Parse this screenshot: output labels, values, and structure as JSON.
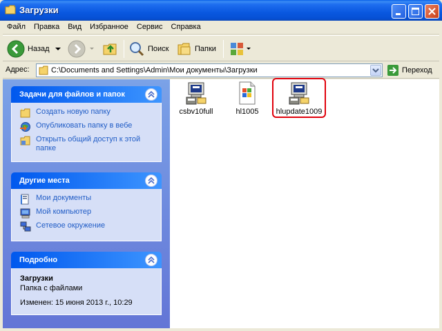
{
  "window": {
    "title": "Загрузки"
  },
  "menu": [
    "Файл",
    "Правка",
    "Вид",
    "Избранное",
    "Сервис",
    "Справка"
  ],
  "toolbar": {
    "back_label": "Назад",
    "search_label": "Поиск",
    "folders_label": "Папки"
  },
  "address": {
    "label": "Адрес:",
    "path": "C:\\Documents and Settings\\Admin\\Мои документы\\Загрузки",
    "go_label": "Переход"
  },
  "tasks_panel": {
    "title": "Задачи для файлов и папок",
    "items": [
      {
        "label": "Создать новую папку",
        "icon": "new-folder-icon"
      },
      {
        "label": "Опубликовать папку в вебе",
        "icon": "publish-web-icon"
      },
      {
        "label": "Открыть общий доступ к этой папке",
        "icon": "share-folder-icon"
      }
    ]
  },
  "places_panel": {
    "title": "Другие места",
    "items": [
      {
        "label": "Мои документы",
        "icon": "my-documents-icon"
      },
      {
        "label": "Мой компьютер",
        "icon": "my-computer-icon"
      },
      {
        "label": "Сетевое окружение",
        "icon": "network-icon"
      }
    ]
  },
  "details_panel": {
    "title": "Подробно",
    "name": "Загрузки",
    "type": "Папка с файлами",
    "modified": "Изменен: 15 июня 2013 г., 10:29"
  },
  "files": [
    {
      "name": "csbv10full",
      "icon": "installer-icon"
    },
    {
      "name": "hl1005",
      "icon": "windows-installer-icon"
    },
    {
      "name": "hlupdate1009",
      "icon": "installer-icon",
      "selected": true
    }
  ],
  "colors": {
    "titlebar": "#0a58e0",
    "panel_link": "#215dc6",
    "highlight_outline": "#e0000b"
  }
}
